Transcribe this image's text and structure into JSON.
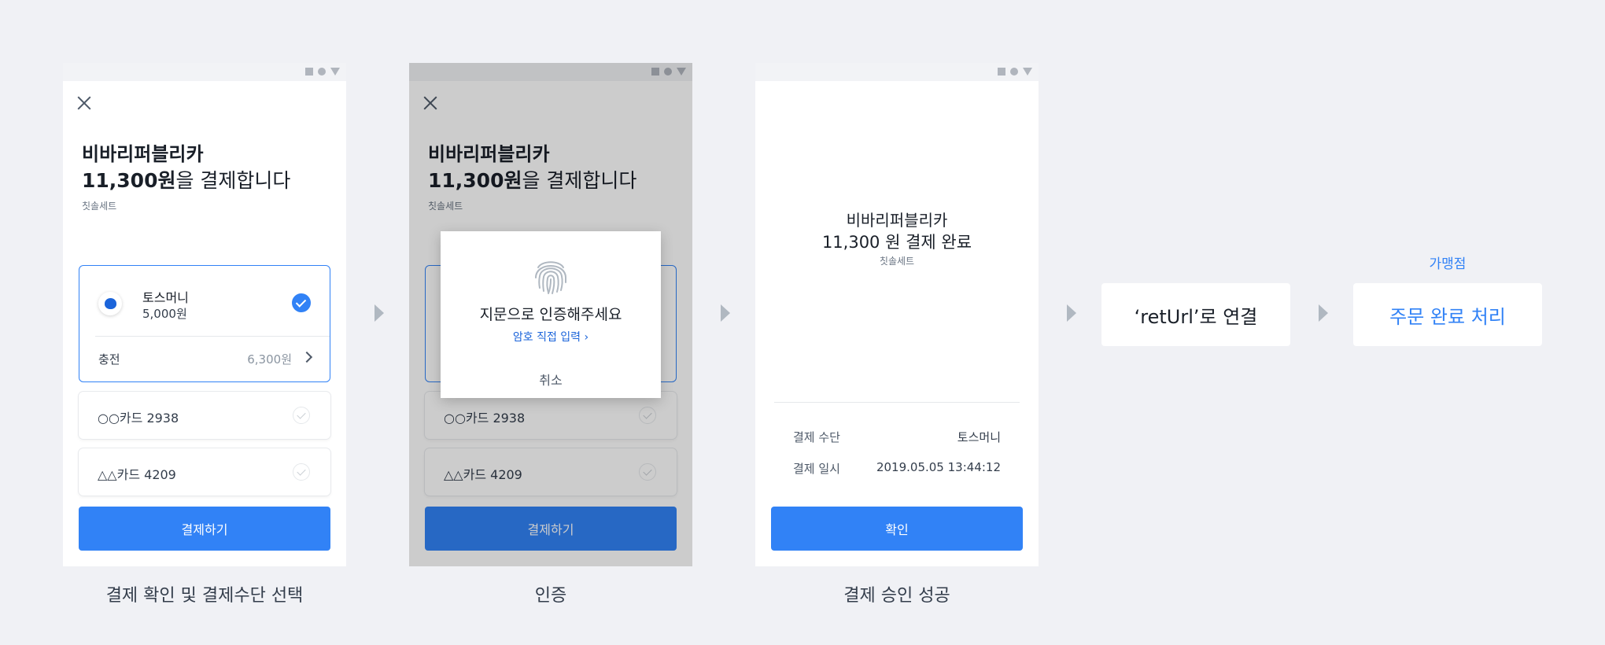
{
  "screen1": {
    "title": "비바리퍼블리카",
    "amount": "11,300원",
    "amount_suffix": "을 결제합니다",
    "item": "칫솔세트",
    "toss_money": {
      "name": "토스머니",
      "balance": "5,000원"
    },
    "charge": {
      "label": "충전",
      "amount": "6,300원"
    },
    "cards": [
      "○○카드 2938",
      "△△카드 4209"
    ],
    "pay_button": "결제하기",
    "caption": "결제 확인 및 결제수단 선택"
  },
  "screen2": {
    "title": "비바리퍼블리카",
    "amount": "11,300원",
    "amount_suffix": "을 결제합니다",
    "item": "칫솔세트",
    "cards": [
      "○○카드 2938",
      "△△카드 4209"
    ],
    "pay_button": "결제하기",
    "dialog": {
      "title": "지문으로 인증해주세요",
      "link": "암호 직접 입력 ›",
      "cancel": "취소"
    },
    "caption": "인증"
  },
  "screen3": {
    "merchant": "비바리퍼블리카",
    "result": "11,300 원 결제 완료",
    "item": "칫솔세트",
    "details": [
      {
        "key": "결제 수단",
        "value": "토스머니"
      },
      {
        "key": "결제 일시",
        "value": "2019.05.05 13:44:12"
      }
    ],
    "confirm_button": "확인",
    "caption": "결제 승인 성공"
  },
  "flow": {
    "ret_url": "‘retUrl’로 연결",
    "merchant_label": "가맹점",
    "order_complete": "주문 완료 처리"
  },
  "colors": {
    "primary": "#3182f6",
    "background": "#f0f1f5",
    "arrow": "#b0b8c1"
  }
}
